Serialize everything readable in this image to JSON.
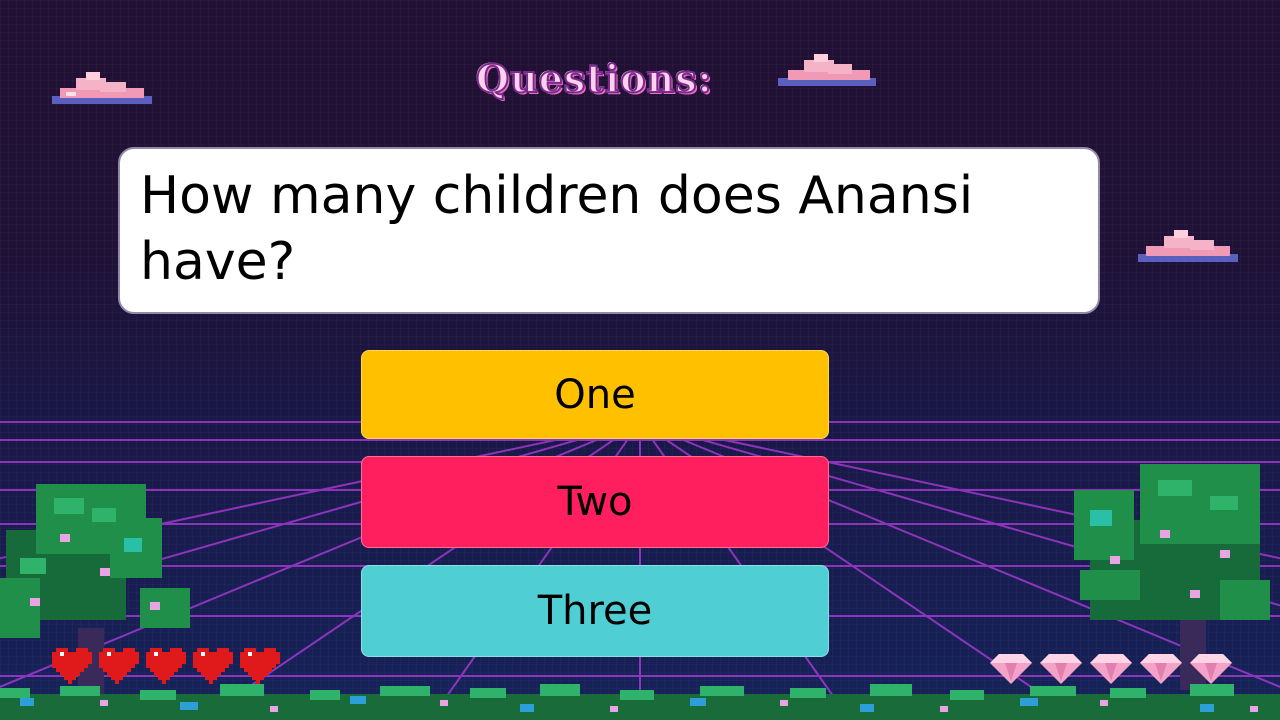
{
  "title": "Questions:",
  "question": "How many children does Anansi have?",
  "answers": [
    {
      "label": "One",
      "color": "#ffc000"
    },
    {
      "label": "Two",
      "color": "#ff1f5e"
    },
    {
      "label": "Three",
      "color": "#4fcfd3"
    }
  ],
  "lives": {
    "count": 5,
    "icon": "heart-icon"
  },
  "gems": {
    "count": 5,
    "icon": "diamond-icon"
  },
  "colors": {
    "background_top": "#221034",
    "background_bottom": "#16235a",
    "grid": "#b43ce0",
    "foliage": "#1f8f4a"
  }
}
